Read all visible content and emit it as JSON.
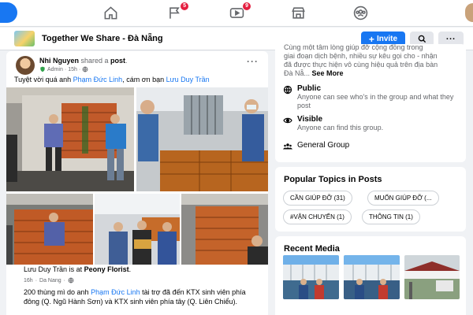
{
  "nav": {
    "items": [
      {
        "icon": "home-icon",
        "badge": ""
      },
      {
        "icon": "flag-icon",
        "badge": "5"
      },
      {
        "icon": "video-icon",
        "badge": "9"
      },
      {
        "icon": "marketplace-icon",
        "badge": ""
      },
      {
        "icon": "groups-icon",
        "badge": ""
      }
    ]
  },
  "group": {
    "name": "Together We Share - Đà Nẵng",
    "invite_label": "Invite"
  },
  "post": {
    "author": "Nhi Nguyen",
    "action": " shared a ",
    "post_link": "post",
    "role": "Admin",
    "time": "15h",
    "text_pre": "Tuyệt vời quá anh ",
    "mention1": "Phạm Đức Linh",
    "text_mid": ", cám ơn bạn ",
    "mention2": "Lưu Duy Trần",
    "shared": {
      "author": "Lưu Duy Trần",
      "action": " is at ",
      "place": "Peony Florist",
      "place_end": ".",
      "time": "16h",
      "location": "Da Nang",
      "text_pre": "200 thùng mì do anh ",
      "mention": "Phạm Đức Linh",
      "text_post": " tài trợ đã đến KTX sinh viên phía đông (Q. Ngũ Hành Sơn) và KTX sinh viên phía tây (Q. Liên Chiểu)."
    }
  },
  "about": {
    "clip_lines": [
      "Cùng một tâm lòng giúp đỡ cộng đồng trong",
      "giai đoạn dịch bệnh, nhiều sự kêu gọi cho - nhận",
      "đã được thực hiện vô cùng hiệu quả trên địa bàn",
      "Đà Nẵ..."
    ],
    "see_more": "See More",
    "public_title": "Public",
    "public_desc": "Anyone can see who's in the group and what they post",
    "visible_title": "Visible",
    "visible_desc": "Anyone can find this group.",
    "general_group": "General Group"
  },
  "popular": {
    "title": "Popular Topics in Posts",
    "topics": [
      "CẦN GIÚP ĐỠ (31)",
      "MUỐN GIÚP ĐỠ (...",
      "#VẬN CHUYỂN (1)",
      "THÔNG TIN (1)"
    ]
  },
  "media": {
    "title": "Recent Media"
  }
}
